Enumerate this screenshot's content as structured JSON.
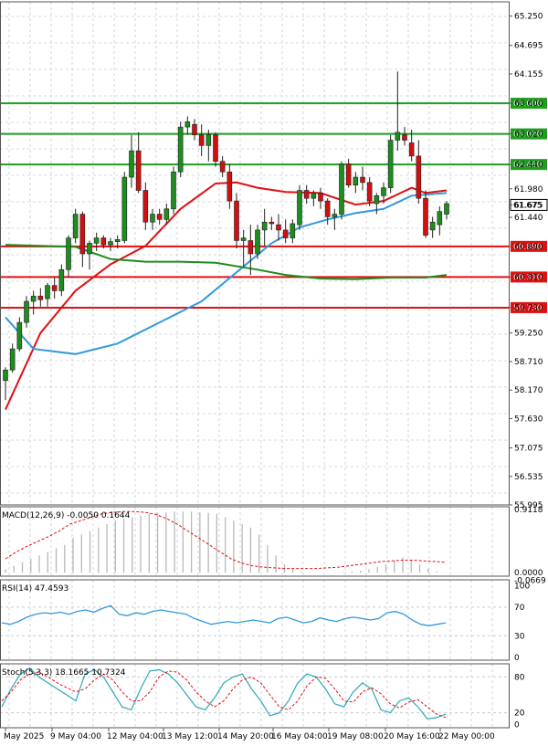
{
  "chart_data": [
    {
      "type": "candlestick",
      "panel": "price",
      "ylim": [
        55.995,
        65.52
      ],
      "y_ticks": [
        "65.250",
        "64.695",
        "64.155",
        "63.600",
        "63.020",
        "62.440",
        "61.980",
        "61.675",
        "61.440",
        "60.890",
        "60.310",
        "59.730",
        "59.250",
        "58.710",
        "58.170",
        "57.630",
        "57.075",
        "56.535",
        "55.995"
      ],
      "current_price": 61.675,
      "current_price_label": "61.675",
      "levels": [
        {
          "value": 63.6,
          "label": "63.600",
          "color": "#1e9e1e"
        },
        {
          "value": 63.02,
          "label": "63.020",
          "color": "#1e9e1e"
        },
        {
          "value": 62.44,
          "label": "62.440",
          "color": "#1e9e1e"
        },
        {
          "value": 60.89,
          "label": "60.890",
          "color": "#e01010"
        },
        {
          "value": 60.31,
          "label": "60.310",
          "color": "#e01010"
        },
        {
          "value": 59.73,
          "label": "59.730",
          "color": "#e01010"
        }
      ],
      "candles": [
        [
          58.35,
          58.6,
          57.98,
          58.55
        ],
        [
          58.55,
          59.05,
          58.5,
          58.95
        ],
        [
          58.95,
          59.55,
          58.9,
          59.45
        ],
        [
          59.45,
          59.95,
          59.35,
          59.85
        ],
        [
          59.85,
          60.05,
          59.6,
          59.95
        ],
        [
          59.95,
          60.1,
          59.75,
          59.88
        ],
        [
          59.9,
          60.2,
          59.75,
          60.15
        ],
        [
          60.15,
          60.3,
          59.9,
          60.05
        ],
        [
          60.05,
          60.55,
          59.95,
          60.45
        ],
        [
          60.45,
          61.1,
          60.3,
          61.05
        ],
        [
          61.05,
          61.6,
          60.95,
          61.5
        ],
        [
          61.5,
          61.55,
          60.5,
          60.75
        ],
        [
          60.75,
          61.0,
          60.45,
          60.95
        ],
        [
          60.95,
          61.15,
          60.8,
          61.05
        ],
        [
          61.05,
          61.1,
          60.85,
          60.92
        ],
        [
          60.92,
          61.05,
          60.8,
          60.98
        ],
        [
          60.98,
          61.1,
          60.85,
          61.02
        ],
        [
          61.0,
          62.3,
          60.95,
          62.2
        ],
        [
          62.2,
          63.0,
          62.0,
          62.7
        ],
        [
          62.7,
          63.05,
          61.9,
          61.95
        ],
        [
          61.95,
          62.1,
          61.2,
          61.35
        ],
        [
          61.35,
          61.6,
          61.2,
          61.5
        ],
        [
          61.5,
          61.6,
          61.3,
          61.4
        ],
        [
          61.4,
          61.7,
          61.3,
          61.6
        ],
        [
          61.6,
          62.4,
          61.5,
          62.3
        ],
        [
          62.3,
          63.25,
          62.2,
          63.15
        ],
        [
          63.15,
          63.35,
          63.0,
          63.25
        ],
        [
          63.2,
          63.3,
          62.9,
          63.0
        ],
        [
          63.0,
          63.2,
          62.6,
          62.8
        ],
        [
          62.8,
          63.1,
          62.5,
          63.0
        ],
        [
          63.0,
          63.05,
          62.4,
          62.5
        ],
        [
          62.5,
          62.6,
          62.2,
          62.3
        ],
        [
          62.3,
          62.45,
          61.6,
          61.75
        ],
        [
          61.75,
          61.9,
          60.85,
          61.0
        ],
        [
          61.0,
          61.2,
          60.5,
          61.05
        ],
        [
          61.0,
          61.3,
          60.35,
          60.75
        ],
        [
          60.75,
          61.3,
          60.65,
          61.2
        ],
        [
          61.2,
          61.6,
          60.9,
          61.35
        ],
        [
          61.35,
          61.45,
          61.2,
          61.32
        ],
        [
          61.3,
          61.5,
          61.0,
          61.2
        ],
        [
          61.2,
          61.4,
          60.95,
          61.05
        ],
        [
          61.05,
          61.4,
          60.95,
          61.32
        ],
        [
          61.3,
          62.05,
          61.2,
          61.95
        ],
        [
          61.95,
          62.05,
          61.7,
          61.8
        ],
        [
          61.8,
          61.95,
          61.65,
          61.9
        ],
        [
          61.9,
          62.0,
          61.6,
          61.75
        ],
        [
          61.75,
          61.8,
          61.3,
          61.45
        ],
        [
          61.45,
          61.6,
          61.2,
          61.5
        ],
        [
          61.5,
          62.5,
          61.4,
          62.45
        ],
        [
          62.45,
          62.55,
          62.0,
          62.05
        ],
        [
          62.05,
          62.3,
          61.9,
          62.2
        ],
        [
          62.2,
          62.4,
          61.95,
          62.1
        ],
        [
          62.1,
          62.2,
          61.65,
          61.75
        ],
        [
          61.7,
          61.9,
          61.5,
          61.85
        ],
        [
          61.85,
          62.1,
          61.7,
          62.0
        ],
        [
          62.0,
          63.0,
          61.9,
          62.9
        ],
        [
          62.9,
          64.2,
          62.7,
          63.05
        ],
        [
          63.0,
          63.15,
          62.8,
          62.9
        ],
        [
          62.85,
          63.1,
          62.5,
          62.6
        ],
        [
          62.6,
          62.9,
          61.7,
          61.8
        ],
        [
          61.8,
          61.95,
          61.05,
          61.1
        ],
        [
          61.2,
          61.45,
          61.05,
          61.35
        ],
        [
          61.3,
          61.65,
          61.1,
          61.55
        ],
        [
          61.5,
          61.75,
          61.4,
          61.7
        ]
      ],
      "ma_series": [
        {
          "color": "#e01010",
          "points": [
            [
              0,
              57.8
            ],
            [
              5,
              59.25
            ],
            [
              10,
              60.05
            ],
            [
              15,
              60.55
            ],
            [
              20,
              60.9
            ],
            [
              25,
              61.6
            ],
            [
              30,
              62.08
            ],
            [
              33,
              62.1
            ],
            [
              36,
              62.0
            ],
            [
              40,
              61.92
            ],
            [
              45,
              61.9
            ],
            [
              50,
              61.68
            ],
            [
              54,
              61.75
            ],
            [
              58,
              62.0
            ],
            [
              60,
              61.9
            ],
            [
              63,
              61.95
            ]
          ]
        },
        {
          "color": "#3398dd",
          "points": [
            [
              0,
              59.55
            ],
            [
              4,
              58.95
            ],
            [
              10,
              58.85
            ],
            [
              16,
              59.05
            ],
            [
              22,
              59.45
            ],
            [
              28,
              59.85
            ],
            [
              33,
              60.4
            ],
            [
              38,
              60.95
            ],
            [
              42,
              61.25
            ],
            [
              46,
              61.4
            ],
            [
              50,
              61.52
            ],
            [
              54,
              61.6
            ],
            [
              58,
              61.85
            ],
            [
              63,
              61.9
            ]
          ]
        },
        {
          "color": "#1e8c1e",
          "points": [
            [
              0,
              60.92
            ],
            [
              10,
              60.88
            ],
            [
              15,
              60.65
            ],
            [
              20,
              60.6
            ],
            [
              25,
              60.6
            ],
            [
              30,
              60.58
            ],
            [
              36,
              60.45
            ],
            [
              40,
              60.35
            ],
            [
              45,
              60.28
            ],
            [
              50,
              60.27
            ],
            [
              55,
              60.3
            ],
            [
              60,
              60.3
            ],
            [
              63,
              60.35
            ]
          ]
        }
      ]
    },
    {
      "type": "bar+line",
      "panel": "macd",
      "label": "MACD(12,26,9) -0.0050 0.1644",
      "ylim": [
        -0.05,
        0.95
      ],
      "y_ticks": [
        "0.9118",
        "0.0000",
        "-0.0669"
      ],
      "histogram": [
        0.05,
        0.1,
        0.15,
        0.2,
        0.25,
        0.3,
        0.35,
        0.4,
        0.5,
        0.55,
        0.6,
        0.65,
        0.7,
        0.75,
        0.78,
        0.8,
        0.82,
        0.85,
        0.86,
        0.87,
        0.88,
        0.88,
        0.88,
        0.87,
        0.86,
        0.85,
        0.8,
        0.75,
        0.7,
        0.65,
        0.55,
        0.4,
        0.25,
        0.12,
        0.05,
        0.02,
        0.01,
        0.0,
        0.0,
        0.0,
        0.01,
        0.02,
        0.03,
        0.05,
        0.08,
        0.12,
        0.18,
        0.22,
        0.18,
        0.12,
        0.06,
        0.02
      ],
      "signal": [
        0.2,
        0.3,
        0.38,
        0.45,
        0.52,
        0.6,
        0.7,
        0.75,
        0.8,
        0.85,
        0.87,
        0.88,
        0.88,
        0.87,
        0.84,
        0.78,
        0.7,
        0.6,
        0.5,
        0.4,
        0.3,
        0.2,
        0.14,
        0.1,
        0.08,
        0.07,
        0.06,
        0.06,
        0.06,
        0.06,
        0.07,
        0.08,
        0.1,
        0.12,
        0.14,
        0.16,
        0.17,
        0.18,
        0.18,
        0.17,
        0.16,
        0.15
      ]
    },
    {
      "type": "line",
      "panel": "rsi",
      "label": "RSI(14) 47.4593",
      "ylim": [
        -4,
        108
      ],
      "y_ticks": [
        "100",
        "70",
        "30",
        "0"
      ],
      "values": [
        48,
        46,
        50,
        56,
        60,
        62,
        61,
        63,
        60,
        64,
        66,
        63,
        68,
        72,
        60,
        58,
        62,
        60,
        64,
        66,
        64,
        62,
        60,
        54,
        50,
        46,
        48,
        50,
        48,
        50,
        52,
        50,
        48,
        54,
        56,
        52,
        48,
        50,
        55,
        52,
        50,
        54,
        56,
        54,
        52,
        54,
        62,
        64,
        60,
        52,
        46,
        44,
        46,
        48
      ]
    },
    {
      "type": "line",
      "panel": "stochastic",
      "label": "Stoch(5,3,3) 18.1665 10.7324",
      "ylim": [
        -5,
        102
      ],
      "y_ticks": [
        "80",
        "20",
        "0"
      ],
      "k": [
        30,
        60,
        85,
        95,
        80,
        70,
        60,
        50,
        40,
        85,
        92,
        80,
        55,
        30,
        25,
        60,
        90,
        92,
        85,
        70,
        50,
        30,
        25,
        45,
        70,
        80,
        85,
        60,
        40,
        15,
        20,
        40,
        70,
        85,
        80,
        60,
        35,
        30,
        55,
        70,
        60,
        25,
        20,
        40,
        45,
        30,
        10,
        12,
        18
      ],
      "d": [
        40,
        55,
        75,
        85,
        88,
        80,
        70,
        62,
        55,
        60,
        75,
        85,
        75,
        55,
        40,
        40,
        55,
        80,
        90,
        88,
        75,
        55,
        40,
        30,
        40,
        60,
        75,
        80,
        70,
        50,
        30,
        25,
        40,
        65,
        80,
        78,
        60,
        40,
        38,
        55,
        62,
        52,
        35,
        28,
        38,
        42,
        30,
        18,
        12
      ]
    }
  ],
  "x_axis_labels": [
    "May 2025",
    "9 May 04:00",
    "12 May 04:00",
    "13 May 12:00",
    "14 May 20:00",
    "16 May 04:00",
    "19 May 08:00",
    "20 May 16:00",
    "22 May 00:00"
  ]
}
